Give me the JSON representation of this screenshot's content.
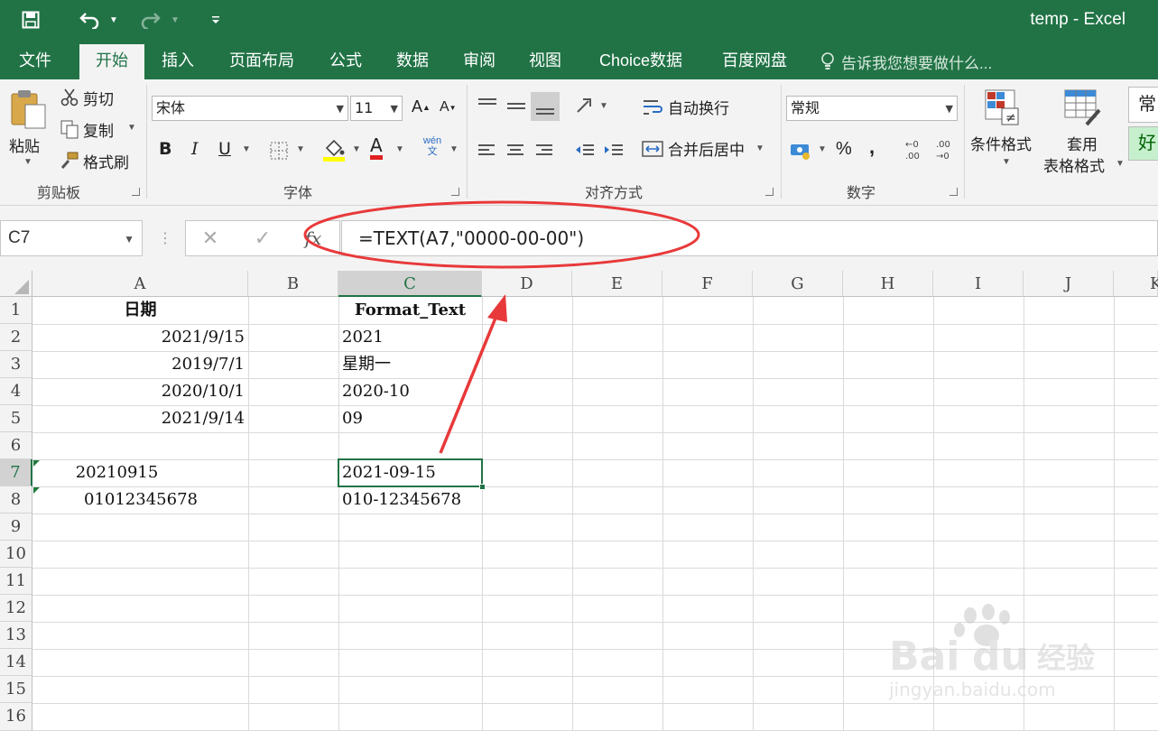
{
  "window": {
    "title": "temp - Excel",
    "accent_color": "#217346"
  },
  "qat": {
    "save_icon": "save-icon",
    "undo_icon": "undo-icon",
    "redo_icon": "redo-icon",
    "customize_icon": "customize-qat-icon"
  },
  "tabs": [
    {
      "label": "文件"
    },
    {
      "label": "开始"
    },
    {
      "label": "插入"
    },
    {
      "label": "页面布局"
    },
    {
      "label": "公式"
    },
    {
      "label": "数据"
    },
    {
      "label": "审阅"
    },
    {
      "label": "视图"
    },
    {
      "label": "Choice数据"
    },
    {
      "label": "百度网盘"
    }
  ],
  "active_tab": "开始",
  "tell_me": "告诉我您想要做什么...",
  "ribbon": {
    "clipboard": {
      "label": "剪贴板",
      "paste": "粘贴",
      "cut": "剪切",
      "copy": "复制",
      "format_painter": "格式刷"
    },
    "font": {
      "label": "字体",
      "font_name": "宋体",
      "font_size": "11",
      "bold": "B",
      "italic": "I",
      "underline": "U",
      "font_color_letter": "A",
      "phonetic": "wén 文"
    },
    "alignment": {
      "label": "对齐方式",
      "wrap_text": "自动换行",
      "merge_center": "合并后居中"
    },
    "number": {
      "label": "数字",
      "format": "常规",
      "percent": "%",
      "comma": ","
    },
    "styles": {
      "conditional": "条件格式",
      "table_format_1": "套用",
      "table_format_2": "表格格式",
      "style_normal": "常",
      "style_good": "好"
    }
  },
  "formula_bar": {
    "name_box": "C7",
    "formula": "=TEXT(A7,\"0000-00-00\")",
    "fx": "fx"
  },
  "columns": [
    "A",
    "B",
    "C",
    "D",
    "E",
    "F",
    "G",
    "H",
    "I",
    "J",
    "K"
  ],
  "rows": [
    "1",
    "2",
    "3",
    "4",
    "5",
    "6",
    "7",
    "8",
    "9",
    "10",
    "11",
    "12",
    "13",
    "14",
    "15",
    "16"
  ],
  "cells": {
    "A1": "日期",
    "C1": "Format_Text",
    "A2": "2021/9/15",
    "C2": "2021",
    "A3": "2019/7/1",
    "C3": "星期一",
    "A4": "2020/10/1",
    "C4": "2020-10",
    "A5": "2021/9/14",
    "C5": "09",
    "A7": "20210915",
    "C7": "2021-09-15",
    "A8": "01012345678",
    "C8": "010-12345678"
  },
  "selected_cell": "C7",
  "annotation_color": "#e8393a",
  "watermark": {
    "logo_text": "Bai du 经验",
    "url": "jingyan.baidu.com"
  }
}
